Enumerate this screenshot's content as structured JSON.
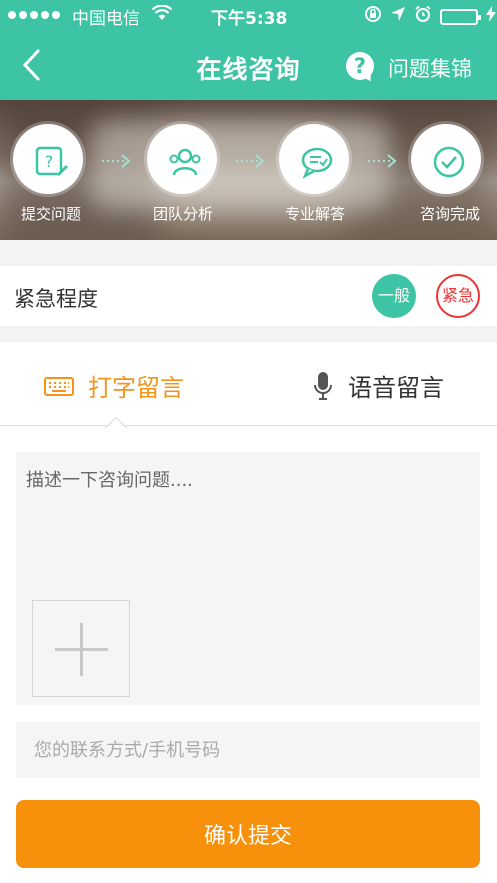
{
  "status_bar": {
    "carrier": "中国电信",
    "time": "下午5:38"
  },
  "nav": {
    "title": "在线咨询",
    "help_glyph": "?",
    "collection_label": "问题集锦"
  },
  "steps": [
    {
      "label": "提交问题",
      "icon": "edit-document-icon"
    },
    {
      "label": "团队分析",
      "icon": "team-icon"
    },
    {
      "label": "专业解答",
      "icon": "chat-bubble-icon"
    },
    {
      "label": "咨询完成",
      "icon": "check-circle-icon"
    }
  ],
  "urgency": {
    "label": "紧急程度",
    "options": [
      "一般",
      "紧急"
    ],
    "selected": "一般"
  },
  "tabs": {
    "typing_label": "打字留言",
    "voice_label": "语音留言",
    "active": "打字留言"
  },
  "form": {
    "description_placeholder": "描述一下咨询问题....",
    "contact_placeholder": "您的联系方式/手机号码"
  },
  "submit_label": "确认提交",
  "colors": {
    "primary": "#3cc4a4",
    "accent": "#f7900a",
    "urgent": "#e33333"
  }
}
